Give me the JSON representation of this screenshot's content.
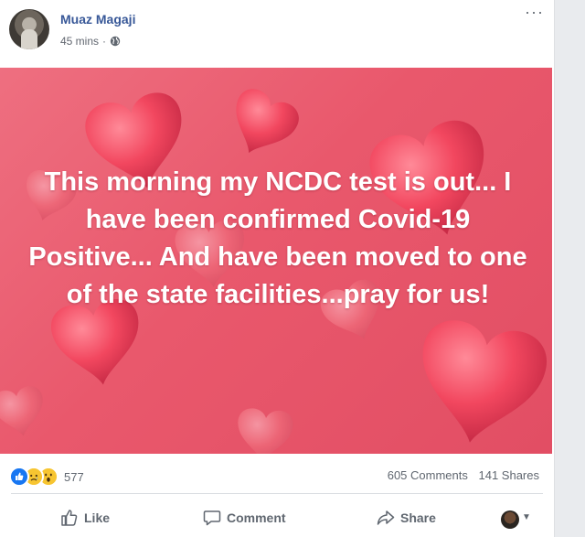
{
  "post": {
    "author": "Muaz Magaji",
    "time": "45 mins",
    "time_separator": "·",
    "privacy_icon": "globe-icon",
    "more_icon": "more-icon",
    "more_glyph": "···",
    "image_text": "This morning my NCDC test is out... I have been confirmed Covid-19 Positive... And have been moved to one of the state facilities...pray for us!",
    "image_colors": {
      "background": "#e9586c",
      "hearts": "#f0475f",
      "text": "#ffffff"
    }
  },
  "stats": {
    "reactions": [
      "like-reaction-icon",
      "sad-reaction-icon",
      "wow-reaction-icon"
    ],
    "reaction_count": "577",
    "comments": "605 Comments",
    "shares": "141 Shares"
  },
  "actions": {
    "like": "Like",
    "comment": "Comment",
    "share": "Share"
  },
  "colors": {
    "author": "#385898",
    "meta": "#616770",
    "like_blue": "#1877f2"
  }
}
